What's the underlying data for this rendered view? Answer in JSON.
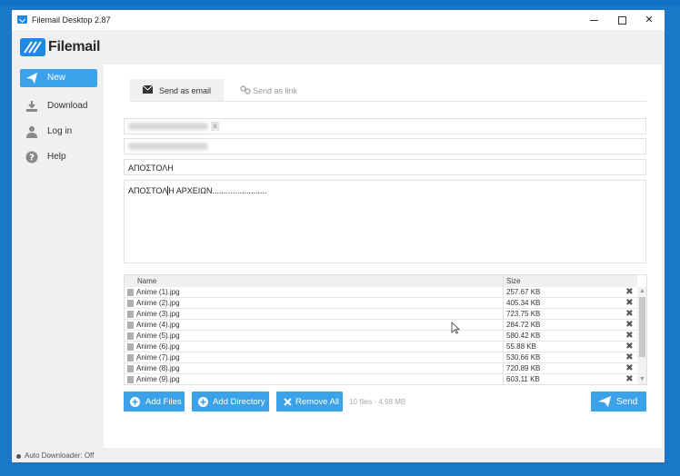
{
  "window": {
    "title": "Filemail Desktop 2.87"
  },
  "brand": {
    "name": "Filemail",
    "accent": "#3ba2ea"
  },
  "sidebar": {
    "items": [
      {
        "label": "New",
        "icon": "send-icon",
        "active": true
      },
      {
        "label": "Download",
        "icon": "download-icon",
        "active": false
      },
      {
        "label": "Log in",
        "icon": "user-icon",
        "active": false
      },
      {
        "label": "Help",
        "icon": "help-icon",
        "active": false
      }
    ]
  },
  "tabs": {
    "email": {
      "label": "Send as email",
      "icon": "envelope-icon",
      "active": true
    },
    "link": {
      "label": "Send as link",
      "icon": "link-icon",
      "active": false
    }
  },
  "form": {
    "subject": "ΑΠΟΣΤΟΛΗ",
    "message_before_caret": "ΑΠΟΣΤΟΛ",
    "message_after_caret": "Η ΑΡΧΕΙΩΝ........................"
  },
  "files": {
    "columns": {
      "name": "Name",
      "size": "Size"
    },
    "rows": [
      {
        "name": "Anime (1).jpg",
        "size": "257.67 KB"
      },
      {
        "name": "Anime (2).jpg",
        "size": "405.34 KB"
      },
      {
        "name": "Anime (3).jpg",
        "size": "723.75 KB"
      },
      {
        "name": "Anime (4).jpg",
        "size": "284.72 KB"
      },
      {
        "name": "Anime (5).jpg",
        "size": "580.42 KB"
      },
      {
        "name": "Anime (6).jpg",
        "size": "55.88 KB"
      },
      {
        "name": "Anime (7).jpg",
        "size": "530.66 KB"
      },
      {
        "name": "Anime (8).jpg",
        "size": "720.89 KB"
      },
      {
        "name": "Anime (9).jpg",
        "size": "603.11 KB"
      }
    ]
  },
  "actions": {
    "add_files": "Add Files",
    "add_directory": "Add Directory",
    "remove_all": "Remove All",
    "summary": "10 files - 4.98 MB",
    "send": "Send"
  },
  "status": {
    "text": "Auto Downloader: Off"
  }
}
